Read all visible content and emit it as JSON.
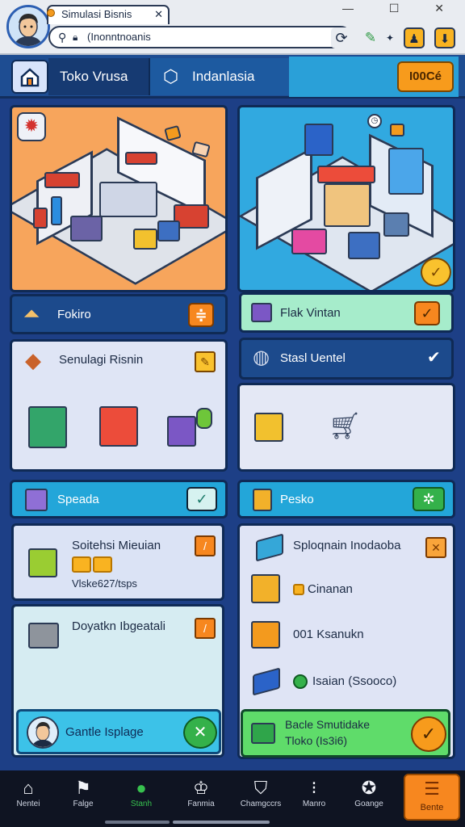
{
  "browser": {
    "tab_title": "Simulasi Bisnis",
    "url": "(Inonntnoanis",
    "tab_close": "✕",
    "window_controls": "— ☐ ✕"
  },
  "nav": {
    "tab_toko": "Toko Vrusa",
    "tab_indo": "Indanlasia",
    "coin_label": "I00Cé"
  },
  "left_col": {
    "header_label": "Fokiro",
    "sim_card_title": "Senulagi Risnin",
    "section_label": "Speada",
    "item1_title": "Soitehsi Mieuian",
    "item1_detail": "Vlske627/tsps",
    "item2_title": "Doyatkn Ibgeatali",
    "bottom_button": "Gantle Isplage"
  },
  "right_col": {
    "header_label": "Flak Vintan",
    "station_label": "Stasl Uentel",
    "section_label": "Pesko",
    "list": [
      {
        "label": "Sploqnain Inodaoba",
        "icon": "truck-icon"
      },
      {
        "label": "Cinanan",
        "icon": "box-icon"
      },
      {
        "label": "001 Ksanukn",
        "icon": "crate-icon"
      },
      {
        "label": "Isaian (Ssooco)",
        "icon": "pallet-icon"
      }
    ],
    "bottom_line1": "Bacle Smutidake",
    "bottom_line2": "Tloko (Is3i6)"
  },
  "bottom_nav": [
    {
      "label": "Nentei",
      "icon": "home-icon"
    },
    {
      "label": "Falge",
      "icon": "flag-icon"
    },
    {
      "label": "Stanh",
      "icon": "leaf-icon"
    },
    {
      "label": "Fanmia",
      "icon": "crown-icon"
    },
    {
      "label": "Chamgccrs",
      "icon": "shield-icon"
    },
    {
      "label": "Manro",
      "icon": "dots-icon"
    },
    {
      "label": "Goange",
      "icon": "gear-icon"
    },
    {
      "label": "Bente",
      "icon": "menu-icon"
    }
  ],
  "colors": {
    "accent_orange": "#f79b1c",
    "panel_blue": "#1e4d92",
    "sky_blue": "#2aa0d8",
    "check_green": "#34b14a"
  }
}
